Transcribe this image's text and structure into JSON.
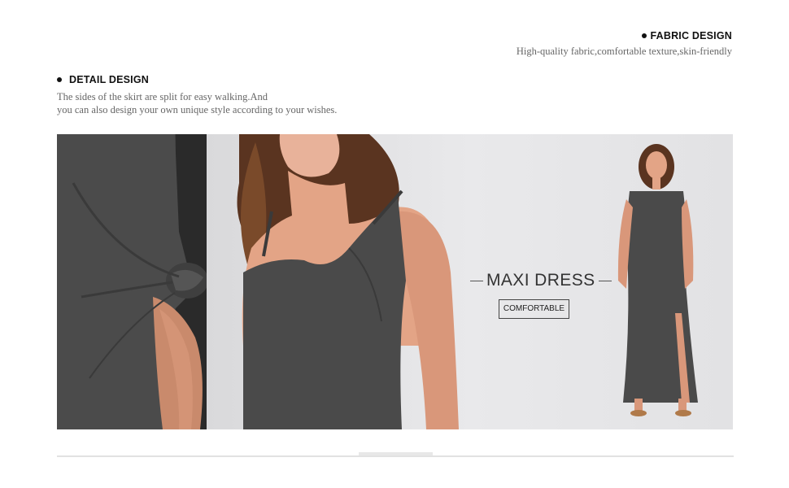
{
  "fabric": {
    "title": "FABRIC DESIGN",
    "description": "High-quality fabric,comfortable texture,skin-friendly"
  },
  "detail": {
    "title": "DETAIL DESIGN",
    "description_line1": "The sides of the skirt are split for easy walking.And",
    "description_line2": "you can also design your own unique style according to your wishes."
  },
  "banner": {
    "headline": "MAXI DRESS",
    "tag": "COMFORTABLE"
  },
  "colors": {
    "dress": "#4a4a4a",
    "background": "#e4e4e6",
    "skin": "#e3a486"
  }
}
